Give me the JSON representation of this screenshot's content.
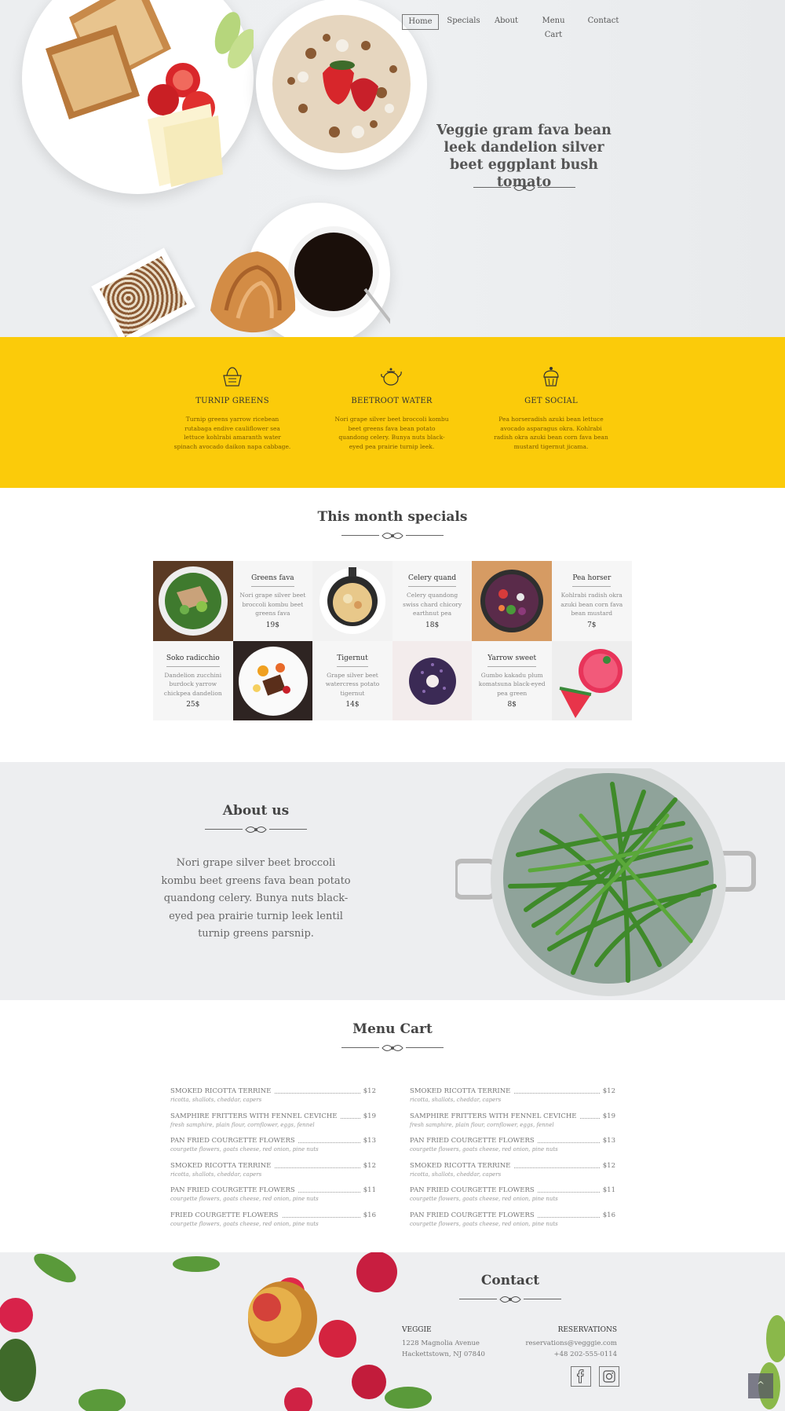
{
  "nav": [
    "Home",
    "Specials",
    "About",
    "Menu Cart",
    "Contact"
  ],
  "hero": {
    "title": "Veggie gram fava bean leek dandelion silver beet eggplant bush tomato"
  },
  "features": [
    {
      "icon": "basket-icon",
      "title": "TURNIP GREENS",
      "text": "Turnip greens yarrow ricebean rutabaga endive cauliflower sea lettuce kohlrabi amaranth water spinach avocado daikon napa cabbage."
    },
    {
      "icon": "teapot-icon",
      "title": "BEETROOT WATER",
      "text": "Nori grape silver beet broccoli kombu beet greens fava bean potato quandong celery. Bunya nuts black-eyed pea prairie turnip leek."
    },
    {
      "icon": "cupcake-icon",
      "title": "GET SOCIAL",
      "text": "Pea horseradish azuki bean lettuce avocado asparagus okra. Kohlrabi radish okra azuki bean corn fava bean mustard tigernut jicama."
    }
  ],
  "specials": {
    "title": "This month specials",
    "items": [
      {
        "name": "Greens fava",
        "desc": "Nori grape silver beet broccoli kombu beet greens fava",
        "price": "19$"
      },
      {
        "name": "Celery quand",
        "desc": "Celery quandong swiss chard chicory earthnut pea",
        "price": "18$"
      },
      {
        "name": "Pea horser",
        "desc": "Kohlrabi radish okra azuki bean corn fava bean mustard",
        "price": "7$"
      },
      {
        "name": "Soko radicchio",
        "desc": "Dandelion zucchini burdock yarrow chickpea dandelion",
        "price": "25$"
      },
      {
        "name": "Tigernut",
        "desc": "Grape silver beet watercress potato tigernut",
        "price": "14$"
      },
      {
        "name": "Yarrow sweet",
        "desc": "Gumbo kakadu plum komatsuna black-eyed pea green",
        "price": "8$"
      }
    ]
  },
  "about": {
    "title": "About us",
    "text": "Nori grape silver beet broccoli kombu beet greens fava bean potato quandong celery. Bunya nuts black-eyed pea prairie turnip leek lentil turnip greens parsnip."
  },
  "menu": {
    "title": "Menu Cart",
    "left": [
      {
        "name": "SMOKED RICOTTA TERRINE",
        "price": "$12",
        "desc": "ricotta, shallots, cheddar, capers"
      },
      {
        "name": "SAMPHIRE FRITTERS WITH FENNEL CEVICHE",
        "price": "$19",
        "desc": "fresh samphire, plain flour, cornflower, eggs, fennel"
      },
      {
        "name": "PAN FRIED COURGETTE FLOWERS",
        "price": "$13",
        "desc": "courgette flowers, goats cheese, red onion, pine nuts"
      },
      {
        "name": "SMOKED RICOTTA TERRINE",
        "price": "$12",
        "desc": "ricotta, shallots, cheddar, capers"
      },
      {
        "name": "PAN FRIED COURGETTE FLOWERS",
        "price": "$11",
        "desc": "courgette flowers, goats cheese, red onion, pine nuts"
      },
      {
        "name": "FRIED COURGETTE FLOWERS",
        "price": "$16",
        "desc": "courgette flowers, goats cheese, red onion, pine nuts"
      }
    ],
    "right": [
      {
        "name": "SMOKED RICOTTA TERRINE",
        "price": "$12",
        "desc": "ricotta, shallots, cheddar, capers"
      },
      {
        "name": "SAMPHIRE FRITTERS WITH FENNEL CEVICHE",
        "price": "$19",
        "desc": "fresh samphire, plain flour, cornflower, eggs, fennel"
      },
      {
        "name": "PAN FRIED COURGETTE FLOWERS",
        "price": "$13",
        "desc": "courgette flowers, goats cheese, red onion, pine nuts"
      },
      {
        "name": "SMOKED RICOTTA TERRINE",
        "price": "$12",
        "desc": "ricotta, shallots, cheddar, capers"
      },
      {
        "name": "PAN FRIED COURGETTE FLOWERS",
        "price": "$11",
        "desc": "courgette flowers, goats cheese, red onion, pine nuts"
      },
      {
        "name": "PAN FRIED COURGETTE FLOWERS",
        "price": "$16",
        "desc": "courgette flowers, goats cheese, red onion, pine nuts"
      }
    ]
  },
  "contact": {
    "title": "Contact",
    "left_heading": "VEGGIE",
    "address1": "1228 Magnolia Avenue",
    "address2": "Hackettstown, NJ 07840",
    "right_heading": "RESERVATIONS",
    "email": "reservations@vegggie.com",
    "phone": "+48 202-555-0114",
    "social": [
      "facebook-icon",
      "instagram-icon"
    ],
    "to_top": "^"
  },
  "colors": {
    "accent": "#fbcb0a",
    "ink": "#444444"
  }
}
